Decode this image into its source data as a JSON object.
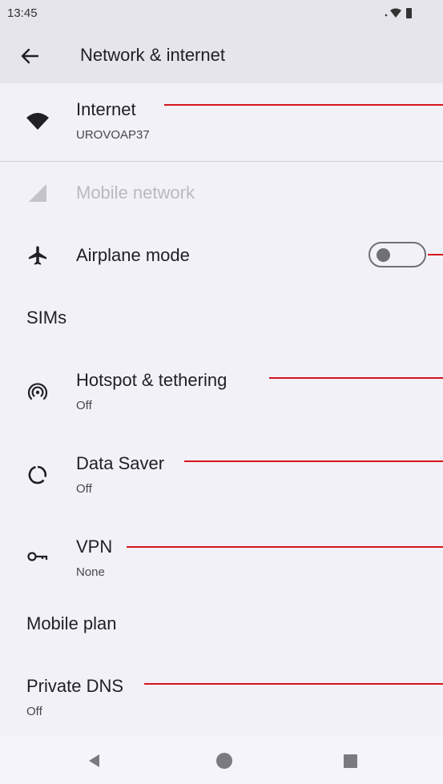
{
  "status": {
    "time": "13:45"
  },
  "appbar": {
    "title": "Network & internet"
  },
  "items": {
    "internet": {
      "title": "Internet",
      "subtitle": "UROVOAP37"
    },
    "mobile_network": {
      "title": "Mobile network"
    },
    "airplane": {
      "title": "Airplane mode",
      "toggle_on": false
    },
    "sims": {
      "title": "SIMs"
    },
    "hotspot": {
      "title": "Hotspot & tethering",
      "subtitle": "Off"
    },
    "data_saver": {
      "title": "Data Saver",
      "subtitle": "Off"
    },
    "vpn": {
      "title": "VPN",
      "subtitle": "None"
    },
    "mobile_plan": {
      "title": "Mobile plan"
    },
    "private_dns": {
      "title": "Private DNS",
      "subtitle": "Off"
    }
  },
  "icons": {
    "back": "arrow-left-icon",
    "wifi": "wifi-icon",
    "signal": "cell-signal-icon",
    "airplane": "airplane-icon",
    "hotspot": "hotspot-icon",
    "data_saver": "data-saver-icon",
    "vpn": "key-icon"
  },
  "colors": {
    "annotation_line": "#d6141c",
    "background": "#f2f1f7",
    "header": "#e6e5eb"
  }
}
